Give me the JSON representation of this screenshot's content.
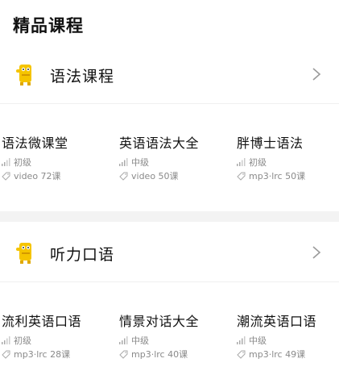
{
  "page": {
    "title": "精品课程"
  },
  "sections": [
    {
      "label": "语法课程",
      "courses": [
        {
          "title": "语法微课堂",
          "level": "初级",
          "tag": "video 72课"
        },
        {
          "title": "英语语法大全",
          "level": "中级",
          "tag": "video 50课"
        },
        {
          "title": "胖博士语法",
          "level": "初级",
          "tag": "mp3·lrc 50课"
        }
      ]
    },
    {
      "label": "听力口语",
      "courses": [
        {
          "title": "流利英语口语",
          "level": "初级",
          "tag": "mp3·lrc 28课"
        },
        {
          "title": "情景对话大全",
          "level": "中级",
          "tag": "mp3·lrc 40课"
        },
        {
          "title": "潮流英语口语",
          "level": "中级",
          "tag": "mp3·lrc 49课"
        }
      ]
    }
  ],
  "colors": {
    "mascot": "#f5c400",
    "meta_text": "#8a8a8a",
    "band": "#f3f3f3"
  },
  "icons": {
    "section": "mascot-icon",
    "more": "chevron-right-icon",
    "level": "signal-bars-icon",
    "tag": "tag-icon"
  }
}
